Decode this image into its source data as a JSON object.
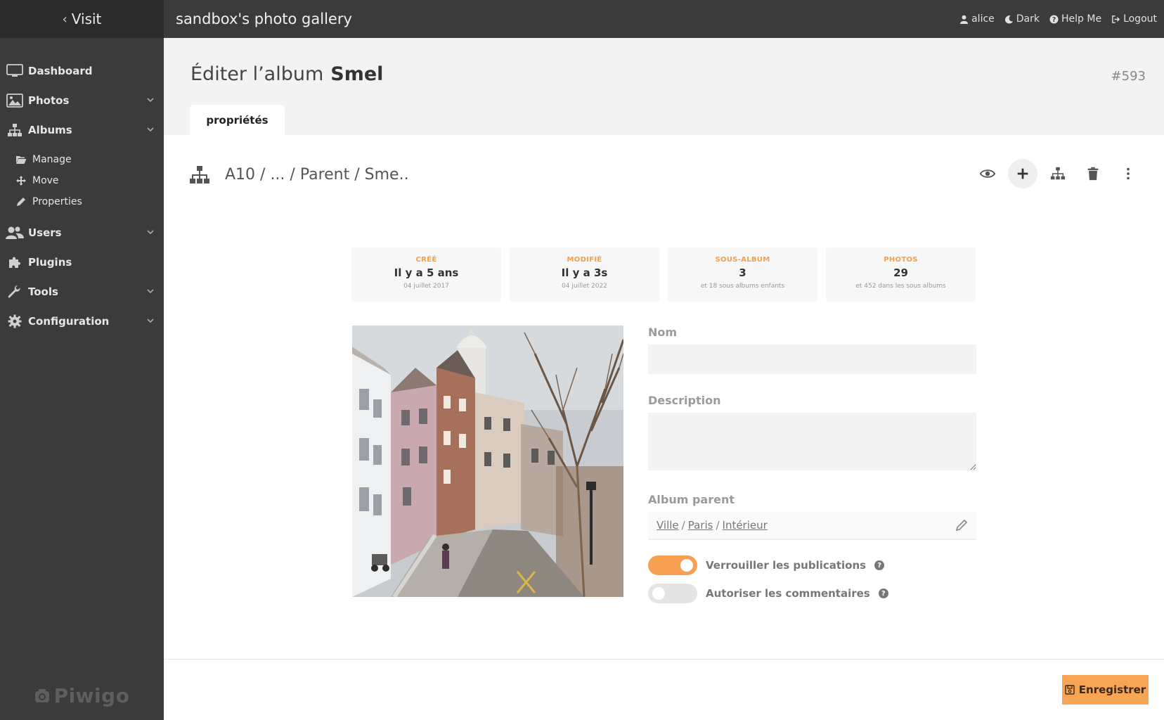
{
  "sidebar": {
    "visit_label": "Visit",
    "items": [
      {
        "label": "Dashboard",
        "icon": "monitor-icon"
      },
      {
        "label": "Photos",
        "icon": "image-icon"
      },
      {
        "label": "Albums",
        "icon": "sitemap-icon"
      },
      {
        "label": "Users",
        "icon": "users-icon"
      },
      {
        "label": "Plugins",
        "icon": "puzzle-icon"
      },
      {
        "label": "Tools",
        "icon": "wrench-icon"
      },
      {
        "label": "Configuration",
        "icon": "gear-icon"
      }
    ],
    "album_subitems": [
      {
        "label": "Manage",
        "icon": "folder-open-icon"
      },
      {
        "label": "Move",
        "icon": "move-icon"
      },
      {
        "label": "Properties",
        "icon": "pencil-icon"
      }
    ],
    "logo": "Piwigo"
  },
  "topbar": {
    "gallery_title": "sandbox's photo gallery",
    "user": "alice",
    "theme": "Dark",
    "help": "Help Me",
    "logout": "Logout"
  },
  "header": {
    "title_prefix": "Éditer l’album",
    "album_name": "Smel",
    "album_id": "#593",
    "tab": "propriétés"
  },
  "content": {
    "breadcrumb": "A10 / ... / Parent / Sme..",
    "stats": [
      {
        "label": "CRÉÉ",
        "value": "Il y a 5 ans",
        "sub": "04 juillet 2017"
      },
      {
        "label": "MODIFIÉ",
        "value": "Il y a 3s",
        "sub": "04 juillet 2022"
      },
      {
        "label": "SOUS-ALBUM",
        "value": "3",
        "sub": "et 18 sous albums enfants"
      },
      {
        "label": "PHOTOS",
        "value": "29",
        "sub": "et 452 dans les sous albums"
      }
    ],
    "form": {
      "name_label": "Nom",
      "name_value": "",
      "description_label": "Description",
      "description_value": "",
      "parent_label": "Album parent",
      "parent_path": [
        "Ville",
        "Paris",
        "Intérieur"
      ],
      "lock_label": "Verrouiller les publications",
      "lock_on": true,
      "comments_label": "Autoriser les commentaires",
      "comments_on": false
    }
  },
  "footer": {
    "save_label": "Enregistrer"
  },
  "colors": {
    "accent": "#f7a052",
    "sidebar_bg": "#3b3b3b",
    "topbar_bg": "#3b3b3b"
  }
}
